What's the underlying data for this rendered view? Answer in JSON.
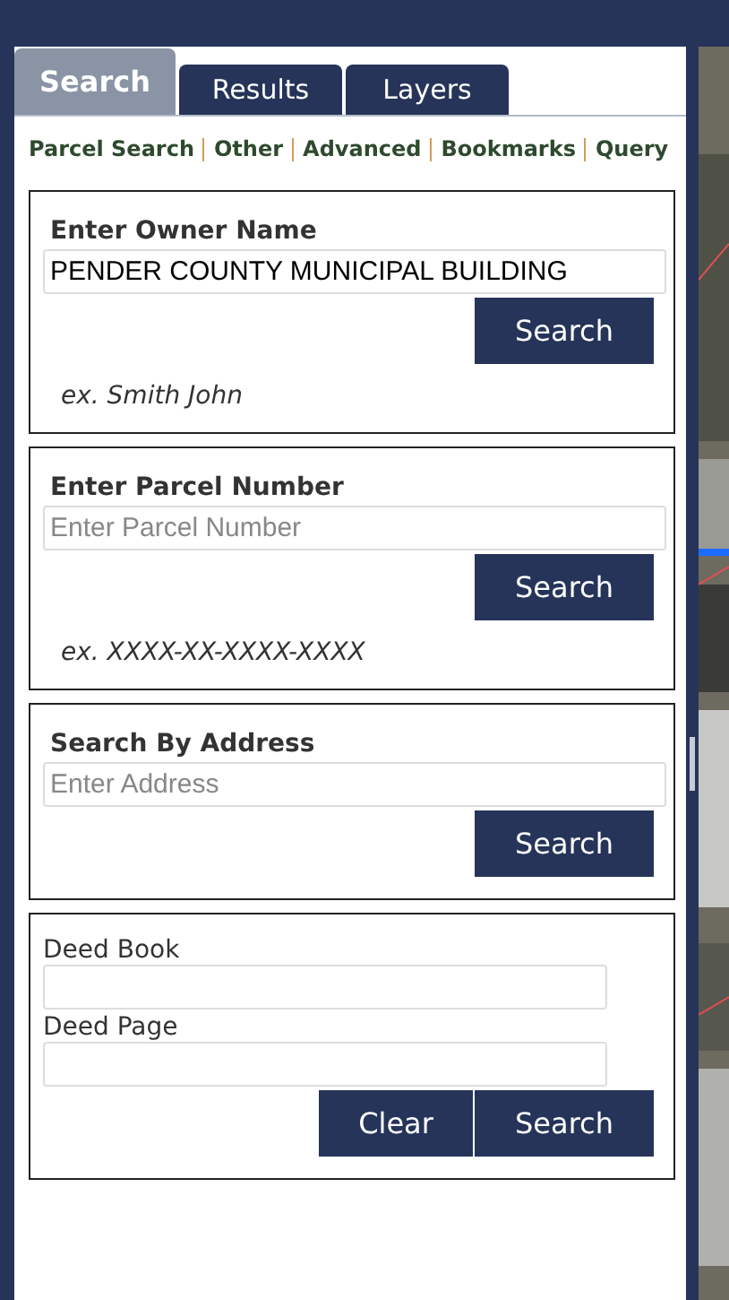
{
  "tabs": [
    {
      "label": "Search",
      "selected": true
    },
    {
      "label": "Results",
      "selected": false
    },
    {
      "label": "Layers",
      "selected": false
    }
  ],
  "links": [
    "Parcel Search",
    "Other",
    "Advanced",
    "Bookmarks",
    "Query"
  ],
  "sections": [
    {
      "kind": "search",
      "heading": "Enter Owner Name",
      "fields": [
        {
          "value": "PENDER COUNTY MUNICIPAL BUILDING"
        }
      ],
      "buttons": [
        "Search"
      ],
      "example": "ex. Smith John"
    },
    {
      "kind": "search",
      "heading": "Enter Parcel Number",
      "fields": [
        {
          "placeholder": "Enter Parcel Number"
        }
      ],
      "buttons": [
        "Search"
      ],
      "example": "ex. XXXX-XX-XXXX-XXXX"
    },
    {
      "kind": "search",
      "heading": "Search By Address",
      "fields": [
        {
          "placeholder": "Enter Address"
        }
      ],
      "buttons": [
        "Search"
      ]
    },
    {
      "kind": "deed",
      "fields": [
        {
          "label": "Deed Book"
        },
        {
          "label": "Deed Page"
        }
      ],
      "buttons": [
        "Clear",
        "Search"
      ]
    }
  ]
}
